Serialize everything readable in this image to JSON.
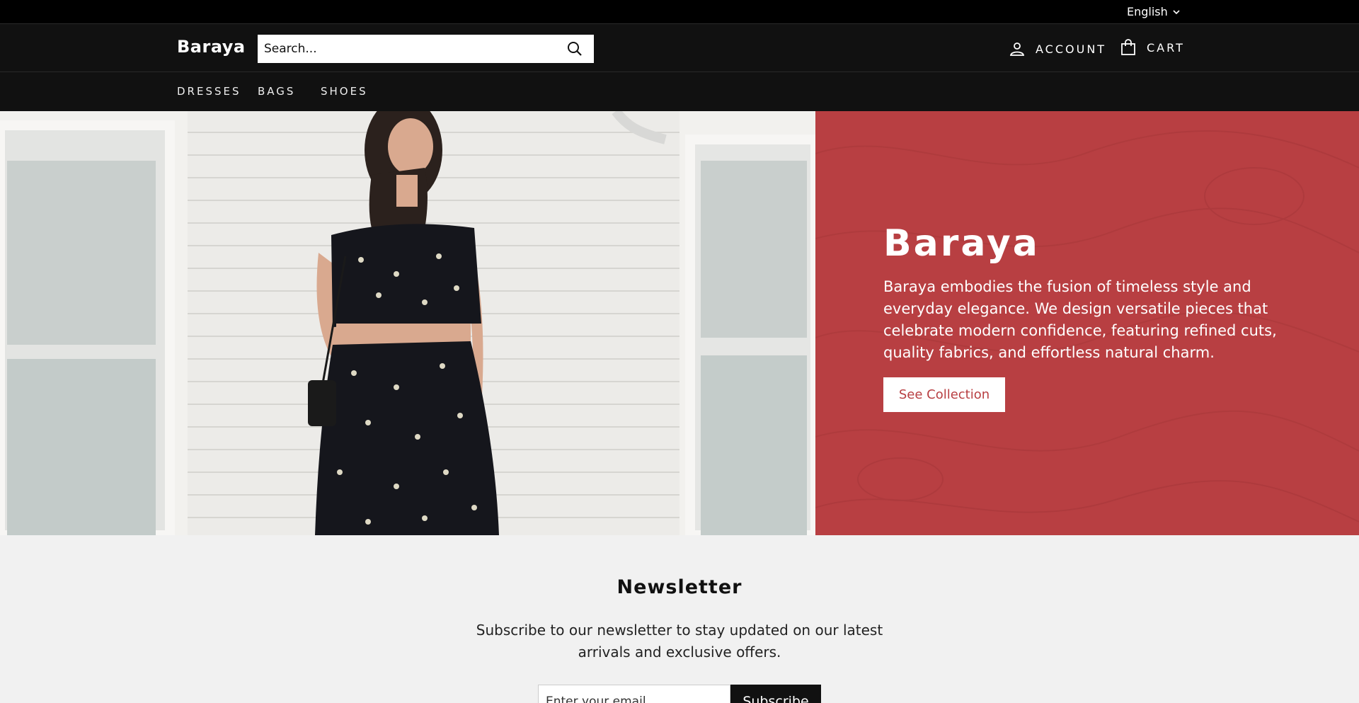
{
  "topbar": {
    "language": "English"
  },
  "header": {
    "logo": "Baraya",
    "search_placeholder": "Search...",
    "account_label": "ACCOUNT",
    "cart_label": "CART"
  },
  "nav": {
    "items": [
      "DRESSES",
      "BAGS",
      "SHOES"
    ]
  },
  "hero": {
    "title": "Baraya",
    "text": "Baraya embodies the fusion of timeless style and everyday elegance. We design versatile pieces that celebrate modern confidence, featuring refined cuts, quality fabrics, and effortless natural charm.",
    "button_label": "See Collection",
    "panel_color": "#b83f42"
  },
  "newsletter": {
    "title": "Newsletter",
    "text": "Subscribe to our newsletter to stay updated on our latest arrivals and exclusive offers.",
    "email_placeholder": "Enter your email",
    "button_label": "Subscribe"
  }
}
